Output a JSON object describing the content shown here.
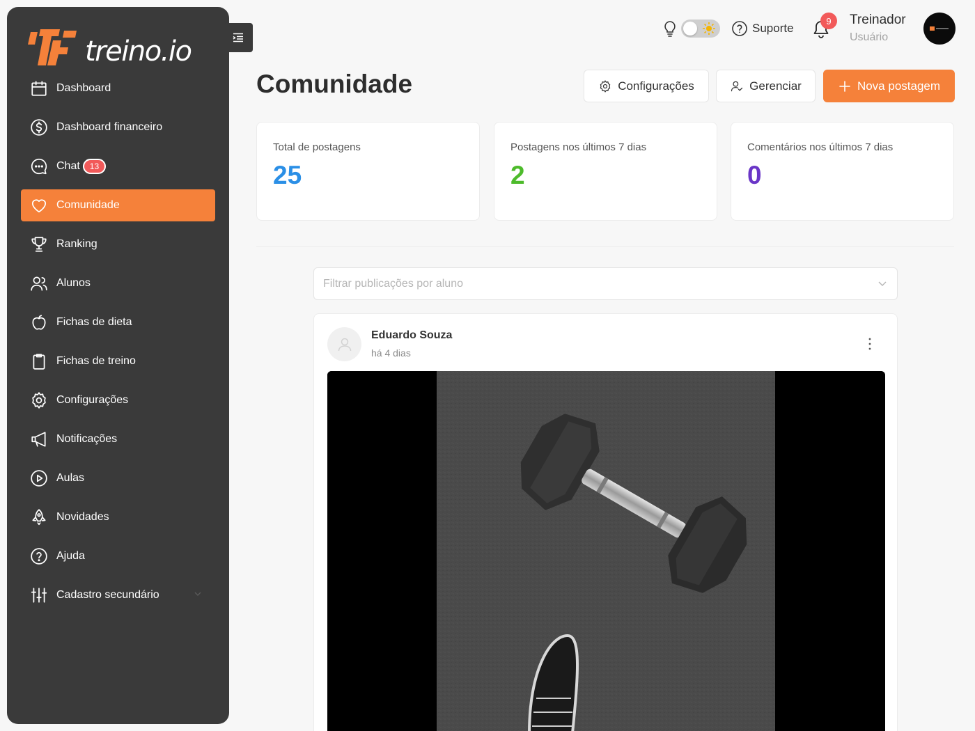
{
  "brand": {
    "name": "treino.io",
    "accent": "#f5813a"
  },
  "sidebar": {
    "items": [
      {
        "label": "Dashboard",
        "icon": "calendar-icon"
      },
      {
        "label": "Dashboard financeiro",
        "icon": "dollar-icon"
      },
      {
        "label": "Chat",
        "icon": "chat-icon",
        "badge": "13"
      },
      {
        "label": "Comunidade",
        "icon": "heart-icon",
        "active": true
      },
      {
        "label": "Ranking",
        "icon": "trophy-icon"
      },
      {
        "label": "Alunos",
        "icon": "users-icon"
      },
      {
        "label": "Fichas de dieta",
        "icon": "apple-icon"
      },
      {
        "label": "Fichas de treino",
        "icon": "clipboard-icon"
      },
      {
        "label": "Configurações",
        "icon": "gear-icon"
      },
      {
        "label": "Notificações",
        "icon": "megaphone-icon"
      },
      {
        "label": "Aulas",
        "icon": "play-icon"
      },
      {
        "label": "Novidades",
        "icon": "rocket-icon"
      },
      {
        "label": "Ajuda",
        "icon": "help-icon"
      },
      {
        "label": "Cadastro secundário",
        "icon": "sliders-icon"
      }
    ]
  },
  "topbar": {
    "support_label": "Suporte",
    "notification_count": "9",
    "user_name": "Treinador",
    "user_role": "Usuário"
  },
  "header": {
    "title": "Comunidade",
    "config_label": "Configurações",
    "manage_label": "Gerenciar",
    "new_post_label": "Nova postagem"
  },
  "stats": [
    {
      "label": "Total de postagens",
      "value": "25",
      "color": "#2b8fe6"
    },
    {
      "label": "Postagens nos últimos 7 dias",
      "value": "2",
      "color": "#4dbb2b"
    },
    {
      "label": "Comentários nos últimos 7 dias",
      "value": "0",
      "color": "#6a36c7"
    }
  ],
  "filter": {
    "placeholder": "Filtrar publicações por aluno"
  },
  "post": {
    "author": "Eduardo Souza",
    "time": "há 4 dias"
  }
}
